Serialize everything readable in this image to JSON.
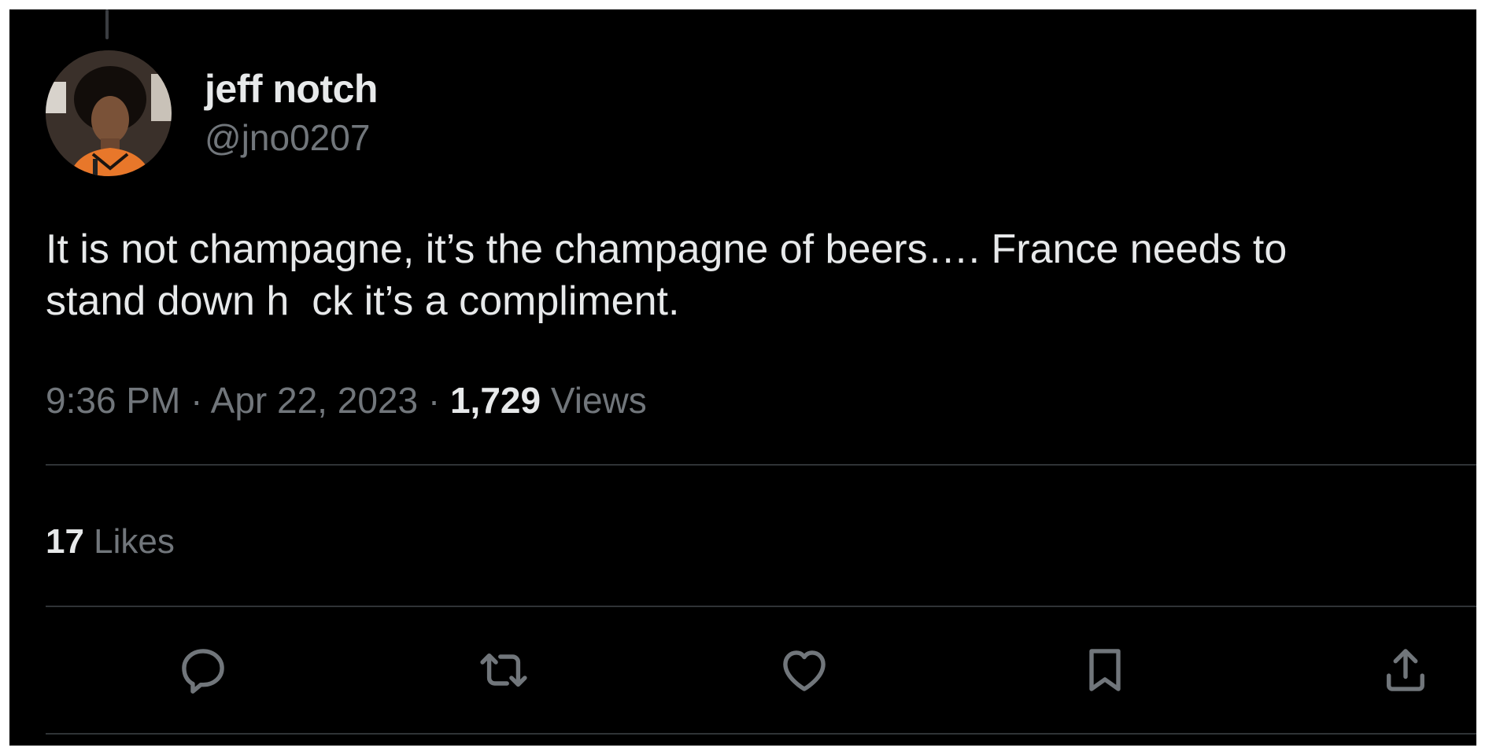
{
  "tweet": {
    "author": {
      "display_name": "jeff notch",
      "handle": "@jno0207"
    },
    "text": "It is not champagne, it’s the champagne of beers…. France needs to\nstand down h  ck it’s a compliment.",
    "time": "9:36 PM",
    "separator": " · ",
    "date": "Apr 22, 2023",
    "views_count": "1,729",
    "views_label": " Views",
    "likes_count": "17",
    "likes_label": " Likes"
  },
  "actions": [
    {
      "name": "reply",
      "icon": "reply-icon"
    },
    {
      "name": "retweet",
      "icon": "retweet-icon"
    },
    {
      "name": "like",
      "icon": "heart-icon"
    },
    {
      "name": "bookmark",
      "icon": "bookmark-icon"
    },
    {
      "name": "share",
      "icon": "share-icon"
    }
  ],
  "colors": {
    "background": "#000000",
    "primary_text": "#e7e9ea",
    "secondary_text": "#71767b",
    "divider": "#2f3336"
  }
}
